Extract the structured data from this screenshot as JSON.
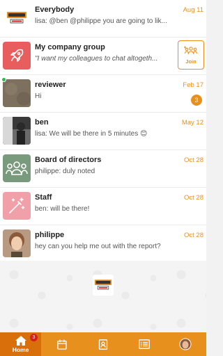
{
  "chats": [
    {
      "name": "Everybody",
      "message": "lisa: @ben @philippe you are going to lik...",
      "time": "Aug 11",
      "avatar": "logo"
    },
    {
      "name": "My company group",
      "message": "\"I want my colleagues to chat altogeth...",
      "join_label": "Join",
      "avatar": "rocket-icon"
    },
    {
      "name": "reviewer",
      "message": "Hi",
      "time": "Feb 17",
      "unread": "3",
      "avatar": "photo"
    },
    {
      "name": "ben",
      "message": "lisa: We will be there in 5 minutes 😊",
      "time": "May 12",
      "avatar": "photo"
    },
    {
      "name": "Board of directors",
      "message": "philippe: duly noted",
      "time": "Oct 28",
      "avatar": "group-icon"
    },
    {
      "name": "Staff",
      "message": "ben: will be there!",
      "time": "Oct 28",
      "avatar": "magic-wand-icon"
    },
    {
      "name": "philippe",
      "message": "hey can you help me out with the report?",
      "time": "Oct 28",
      "avatar": "photo"
    }
  ],
  "tabbar": {
    "home_label": "Home",
    "home_badge": "3",
    "tabs": [
      "home-icon",
      "calendar-icon",
      "contacts-icon",
      "list-icon",
      "profile-avatar"
    ]
  },
  "colors": {
    "accent": "#e8901e",
    "active_tab": "#d96f0a",
    "rocket_bg": "#e85d5d",
    "group_bg": "#7a9a7e",
    "staff_bg": "#f0a0a8",
    "online": "#30b94c"
  }
}
